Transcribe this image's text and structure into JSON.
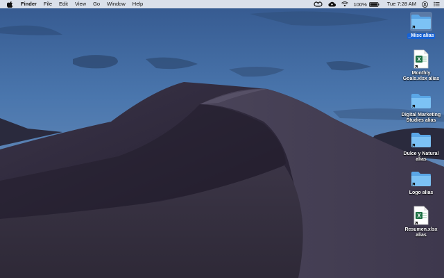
{
  "menubar": {
    "app_name": "Finder",
    "items": [
      "File",
      "Edit",
      "View",
      "Go",
      "Window",
      "Help"
    ],
    "battery_percent": "100%",
    "clock": "Tue 7:28 AM"
  },
  "desktop": {
    "icons": [
      {
        "label": "_Misc alias",
        "type": "folder",
        "selected": true
      },
      {
        "label": "Monthly Goals.xlsx alias",
        "type": "excel",
        "selected": false
      },
      {
        "label": "Digital Marketing Studies alias",
        "type": "folder",
        "selected": false
      },
      {
        "label": "Dulce y Natural alias",
        "type": "folder",
        "selected": false
      },
      {
        "label": "Logo alias",
        "type": "folder",
        "selected": false
      },
      {
        "label": "Resumen.xlsx alias",
        "type": "excel",
        "selected": false
      }
    ]
  },
  "icons": {
    "apple": "apple-logo-icon",
    "creative_cloud": "creative-cloud-icon",
    "icloud": "icloud-upload-icon",
    "wifi": "wifi-icon",
    "battery": "battery-icon",
    "user": "user-account-icon",
    "control": "notification-center-icon"
  },
  "colors": {
    "selection": "#1662d6",
    "folder": "#6cb4ee",
    "excel": "#1d7044"
  }
}
